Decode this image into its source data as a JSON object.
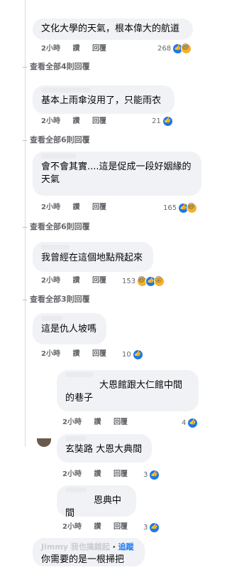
{
  "comments": [
    {
      "text": "文化大學的天氣，根本偉大的航道",
      "time": "2小時",
      "like": "讚",
      "reply": "回覆",
      "count": "268",
      "reactions": [
        "like-icon",
        "haha-icon"
      ],
      "view_more": "查看全部4則回覆"
    },
    {
      "text": "基本上雨傘沒用了，只能雨衣",
      "time": "2小時",
      "like": "讚",
      "reply": "回覆",
      "count": "21",
      "reactions": [
        "like-icon"
      ],
      "view_more": "查看全部6則回覆"
    },
    {
      "text": "會不會其實....這是促成一段好姻緣的天氣",
      "time": "2小時",
      "like": "讚",
      "reply": "回覆",
      "count": "165",
      "reactions": [
        "like-icon",
        "haha-icon"
      ],
      "view_more": "查看全部6則回覆"
    },
    {
      "text": "我曾經在這個地點飛起來",
      "time": "2小時",
      "like": "讚",
      "reply": "回覆",
      "count": "153",
      "reactions": [
        "haha-icon",
        "like-icon",
        "wow-icon"
      ],
      "view_more": "查看全部3則回覆"
    },
    {
      "text": "這是仇人坡嗎",
      "time": "2小時",
      "like": "讚",
      "reply": "回覆",
      "count": "10",
      "reactions": [
        "like-icon"
      ]
    }
  ],
  "replies": [
    {
      "text": "大恩館跟大仁館中間的巷子",
      "time": "2小時",
      "like": "讚",
      "reply": "回覆",
      "count": "4"
    },
    {
      "text": "玄奘路 大恩大典間",
      "time": "2小時",
      "like": "讚",
      "reply": "回覆",
      "count": "3"
    },
    {
      "text": "恩典中間",
      "time": "2小時",
      "like": "讚",
      "reply": "回覆",
      "count": "3"
    }
  ],
  "last_reply": {
    "name_partial": "Jimmy 我也搞錯起",
    "dot": " · ",
    "follow": "追蹤",
    "text": "你需要的是一根掃把"
  },
  "colors": {
    "like": "#1877f2",
    "meta": "#65676b",
    "bubble": "#f0f2f5"
  }
}
